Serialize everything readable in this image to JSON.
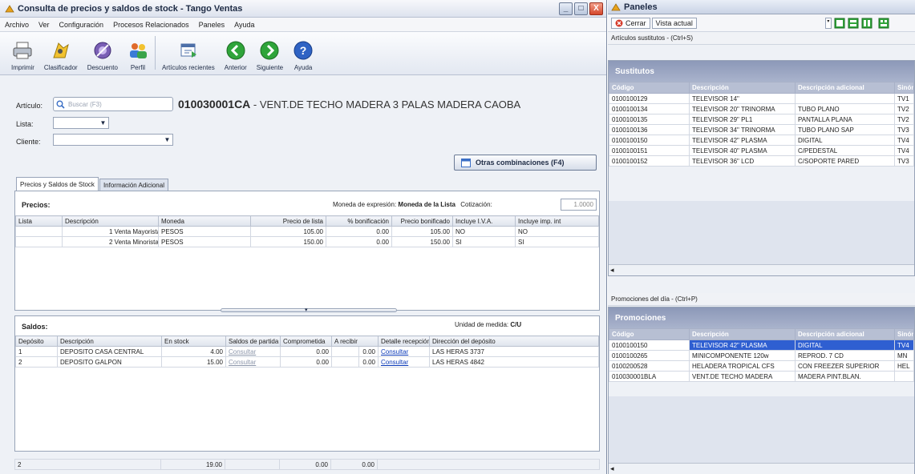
{
  "left_window": {
    "title": "Consulta de precios y saldos de stock - Tango Ventas",
    "controls": {
      "minimize": "_",
      "maximize": "□",
      "close": "X"
    },
    "menu": [
      "Archivo",
      "Ver",
      "Configuración",
      "Procesos Relacionados",
      "Paneles",
      "Ayuda"
    ],
    "toolbar": [
      {
        "label": "Imprimir",
        "icon": "printer-icon"
      },
      {
        "label": "Clasificador",
        "icon": "classifier-icon"
      },
      {
        "label": "Descuento",
        "icon": "discount-icon"
      },
      {
        "label": "Perfil",
        "icon": "profile-icon"
      },
      {
        "label": "Artículos recientes",
        "icon": "recent-items-icon"
      },
      {
        "label": "Anterior",
        "icon": "arrow-left-icon"
      },
      {
        "label": "Siguiente",
        "icon": "arrow-right-icon"
      },
      {
        "label": "Ayuda",
        "icon": "help-icon"
      }
    ],
    "form": {
      "articulo_label": "Artículo:",
      "search_placeholder": "Buscar (F3)",
      "article_code": "010030001CA",
      "article_sep": " - ",
      "article_desc": "VENT.DE TECHO MADERA 3 PALAS MADERA CAOBA",
      "lista_label": "Lista:",
      "cliente_label": "Cliente:",
      "otras_button": "Otras combinaciones (F4)"
    },
    "tabs": [
      "Precios y Saldos de Stock",
      "Información Adicional"
    ],
    "precios": {
      "title": "Precios:",
      "moneda_label": "Moneda de expresión:",
      "moneda_value": "Moneda de la Lista",
      "cotizacion_label": "Cotización:",
      "cotizacion_value": "1.0000",
      "columns": [
        "Lista",
        "Descripción",
        "Moneda",
        "Precio de lista",
        "% bonificación",
        "Precio bonificado",
        "Incluye I.V.A.",
        "Incluye imp. int"
      ],
      "rows": [
        [
          "",
          "1 Venta Mayorista",
          "PESOS",
          "105.00",
          "0.00",
          "105.00",
          "NO",
          "NO"
        ],
        [
          "",
          "2 Venta Minorista",
          "PESOS",
          "150.00",
          "0.00",
          "150.00",
          "SI",
          "SI"
        ]
      ]
    },
    "saldos": {
      "title": "Saldos:",
      "unidad_label": "Unidad de medida:",
      "unidad_value": "C/U",
      "columns": [
        "Depósito",
        "Descripción",
        "En stock",
        "Saldos de partida",
        "Comprometida",
        "A recibir",
        "Detalle recepción",
        "Dirección del depósito"
      ],
      "rows": [
        [
          "1",
          "DEPOSITO CASA CENTRAL",
          "4.00",
          "Consultar",
          "0.00",
          "",
          "0.00",
          "Consultar",
          "LAS HERAS 3737"
        ],
        [
          "2",
          "DEPOSITO GALPON",
          "15.00",
          "Consultar",
          "0.00",
          "",
          "0.00",
          "Consultar",
          "LAS HERAS 4842"
        ]
      ],
      "footer": [
        "2",
        "",
        "19.00",
        "",
        "0.00",
        "",
        "0.00",
        ""
      ]
    }
  },
  "right_window": {
    "title": "Paneles",
    "toolbar": {
      "close_label": "Cerrar",
      "view_label": "Vista actual"
    },
    "sustitutos": {
      "label": "Artículos sustitutos - (Ctrl+S)",
      "header": "Sustitutos",
      "columns": [
        "Código",
        "Descripción",
        "Descripción adicional",
        "Sinón"
      ],
      "rows": [
        [
          "0100100129",
          "TELEVISOR 14\"",
          "",
          "TV1"
        ],
        [
          "0100100134",
          "TELEVISOR 20\" TRINORMA",
          "TUBO PLANO",
          "TV2"
        ],
        [
          "0100100135",
          "TELEVISOR 29\" PL1",
          "PANTALLA PLANA",
          "TV2"
        ],
        [
          "0100100136",
          "TELEVISOR 34\" TRINORMA",
          "TUBO PLANO SAP",
          "TV3"
        ],
        [
          "0100100150",
          "TELEVISOR 42\" PLASMA",
          "DIGITAL",
          "TV4"
        ],
        [
          "0100100151",
          "TELEVISOR 40\" PLASMA",
          "C/PEDESTAL",
          "TV4"
        ],
        [
          "0100100152",
          "TELEVISOR 36\" LCD",
          "C/SOPORTE PARED",
          "TV3"
        ]
      ]
    },
    "promociones": {
      "label": "Promociones del día - (Ctrl+P)",
      "header": "Promociones",
      "columns": [
        "Código",
        "Descripción",
        "Descripción adicional",
        "Sinón"
      ],
      "rows": [
        [
          "0100100150",
          "TELEVISOR 42\" PLASMA",
          "DIGITAL",
          "TV4"
        ],
        [
          "0100100265",
          "MINICOMPONENTE 120w",
          "REPROD. 7 CD",
          "MN"
        ],
        [
          "0100200528",
          "HELADERA TROPICAL CFS",
          "CON FREEZER SUPERIOR",
          "HEL"
        ],
        [
          "010030001BLA",
          "VENT.DE TECHO MADERA",
          "MADERA PINT.BLAN.",
          ""
        ]
      ]
    }
  }
}
